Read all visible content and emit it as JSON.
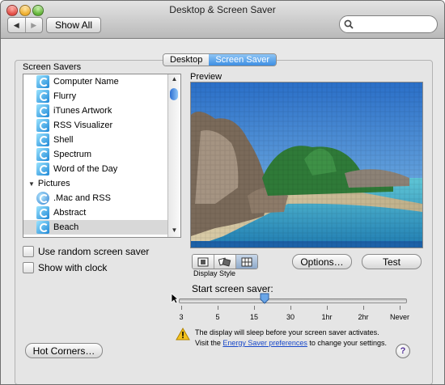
{
  "window": {
    "title": "Desktop & Screen Saver"
  },
  "toolbar": {
    "back_label": "◀",
    "forward_label": "▶",
    "show_all_label": "Show All",
    "search_placeholder": ""
  },
  "tabs": [
    {
      "label": "Desktop"
    },
    {
      "label": "Screen Saver"
    }
  ],
  "screen_savers": {
    "label": "Screen Savers",
    "items": [
      {
        "label": "Computer Name"
      },
      {
        "label": "Flurry"
      },
      {
        "label": "iTunes Artwork"
      },
      {
        "label": "RSS Visualizer"
      },
      {
        "label": "Shell"
      },
      {
        "label": "Spectrum"
      },
      {
        "label": "Word of the Day"
      },
      {
        "label": "Pictures"
      },
      {
        "label": ".Mac and RSS"
      },
      {
        "label": "Abstract"
      },
      {
        "label": "Beach"
      }
    ]
  },
  "checkboxes": {
    "random_label": "Use random screen saver",
    "clock_label": "Show with clock"
  },
  "preview": {
    "label": "Preview"
  },
  "display_style": {
    "label": "Display Style"
  },
  "buttons": {
    "options_label": "Options…",
    "test_label": "Test",
    "hot_corners_label": "Hot Corners…"
  },
  "start": {
    "label": "Start screen saver:",
    "ticks": [
      "3",
      "5",
      "15",
      "30",
      "1hr",
      "2hr",
      "Never"
    ],
    "value": "15"
  },
  "warning": {
    "line1": "The display will sleep before your screen saver activates.",
    "line2_prefix": "Visit the ",
    "link": "Energy Saver preferences",
    "line2_suffix": " to change your settings."
  },
  "help_label": "?"
}
